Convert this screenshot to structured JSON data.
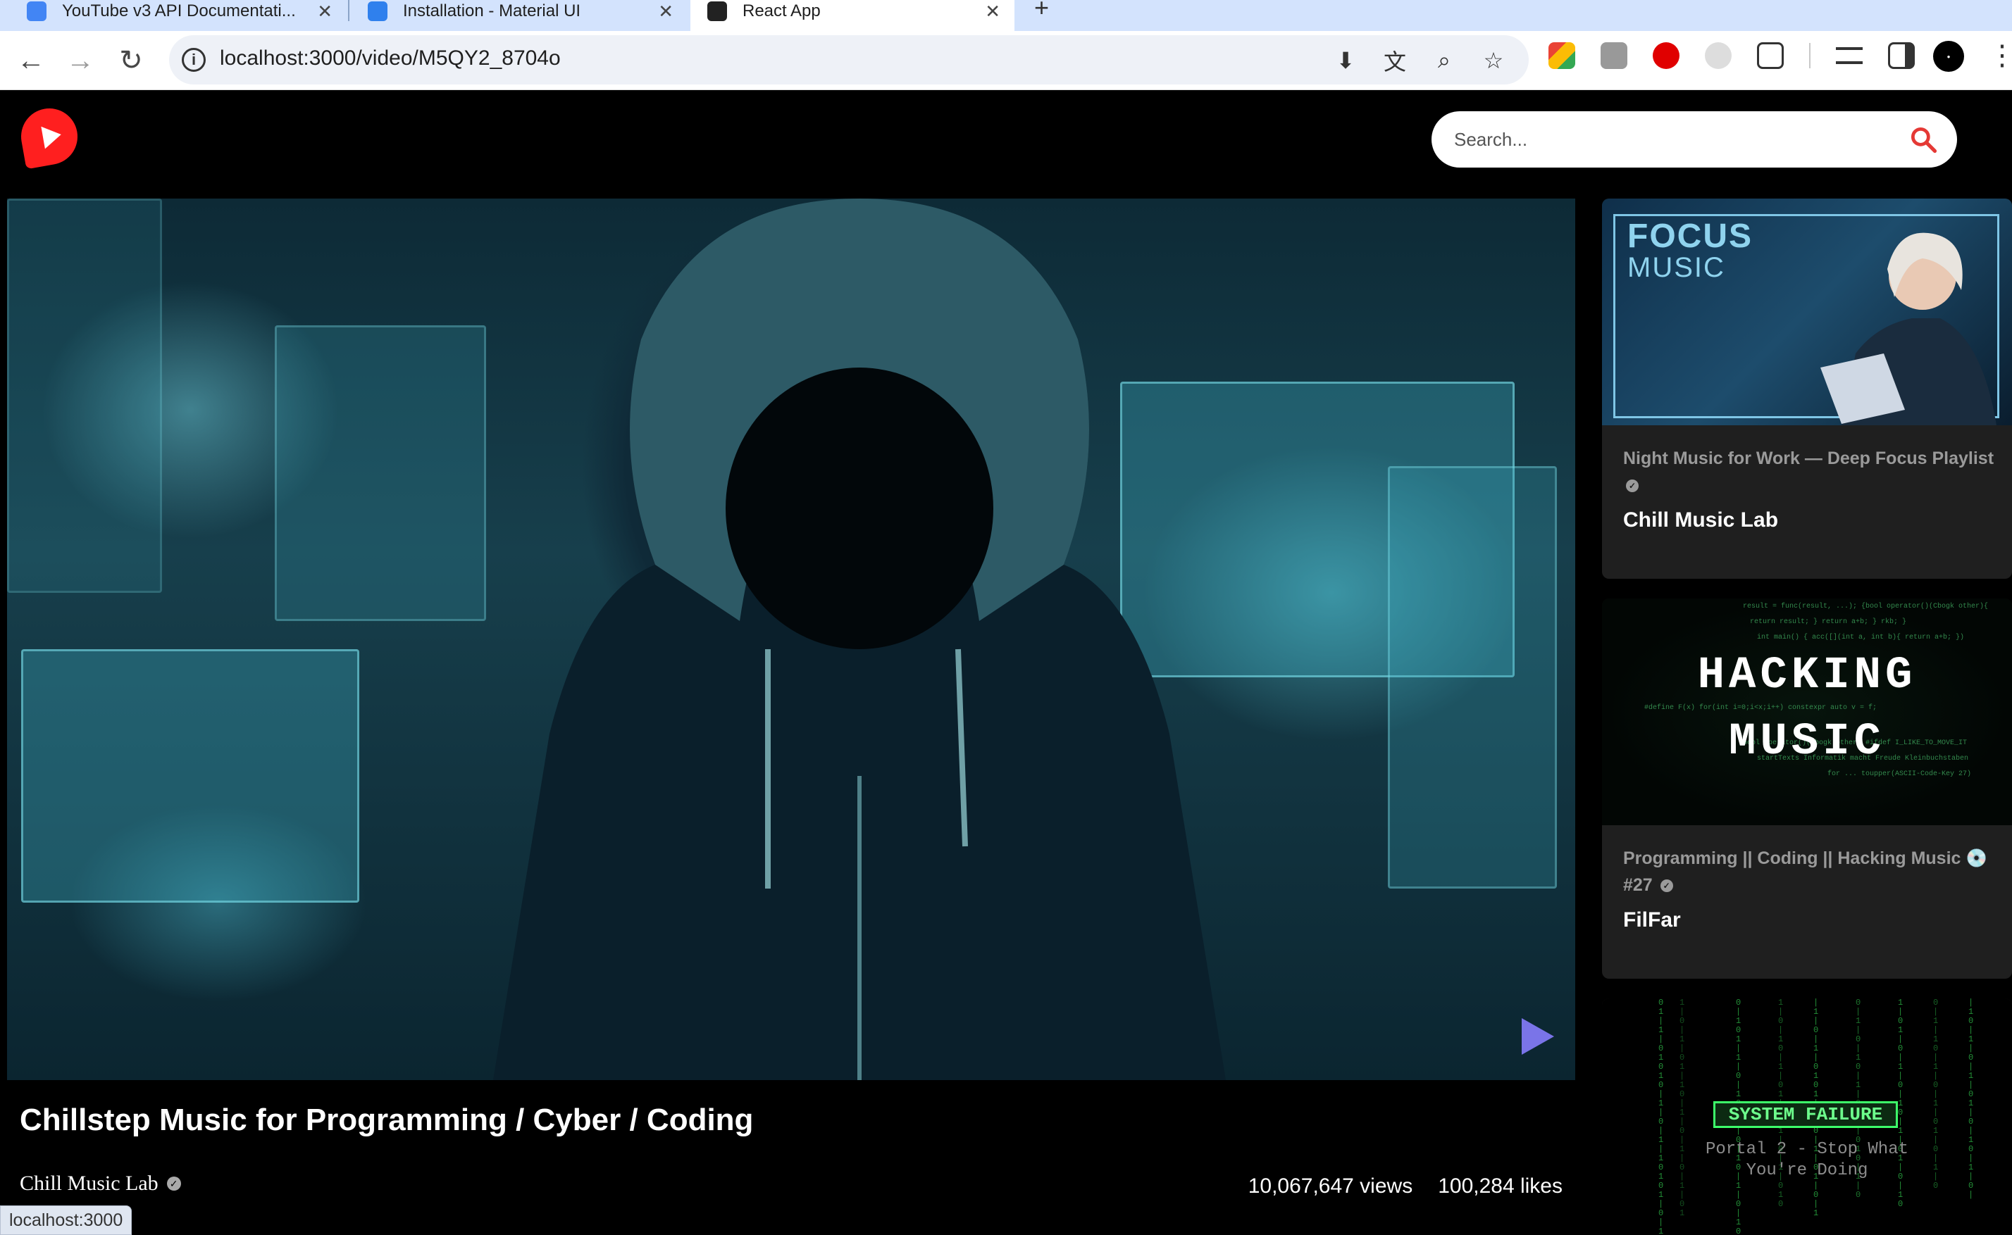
{
  "browser": {
    "tabs": [
      {
        "title": "YouTube v3 API Documentati..."
      },
      {
        "title": "Installation - Material UI"
      },
      {
        "title": "React App"
      }
    ],
    "url": "localhost:3000/video/M5QY2_8704o",
    "status_url": "localhost:3000"
  },
  "app": {
    "search": {
      "placeholder": "Search..."
    }
  },
  "video": {
    "title": "Chillstep Music for Programming / Cyber / Coding",
    "channel": "Chill Music Lab",
    "views": "10,067,647 views",
    "likes": "100,284 likes"
  },
  "related": [
    {
      "title": "Night Music for Work — Deep Focus Playlist",
      "channel": "Chill Music Lab",
      "thumb_text": [
        "FOCUS",
        "MUSIC"
      ]
    },
    {
      "title": "Programming || Coding || Hacking Music 💿 #27",
      "channel": "FilFar",
      "thumb_text": [
        "HACKING",
        "MUSIC"
      ]
    },
    {
      "title": "",
      "channel": "",
      "thumb_text": [
        "SYSTEM FAILURE",
        "Portal 2 - Stop What",
        "You're Doing"
      ]
    }
  ],
  "colors": {
    "brand": "#ff1f1f",
    "background": "#000000",
    "card": "#1f1f1f",
    "search_icon": "#e53935"
  }
}
